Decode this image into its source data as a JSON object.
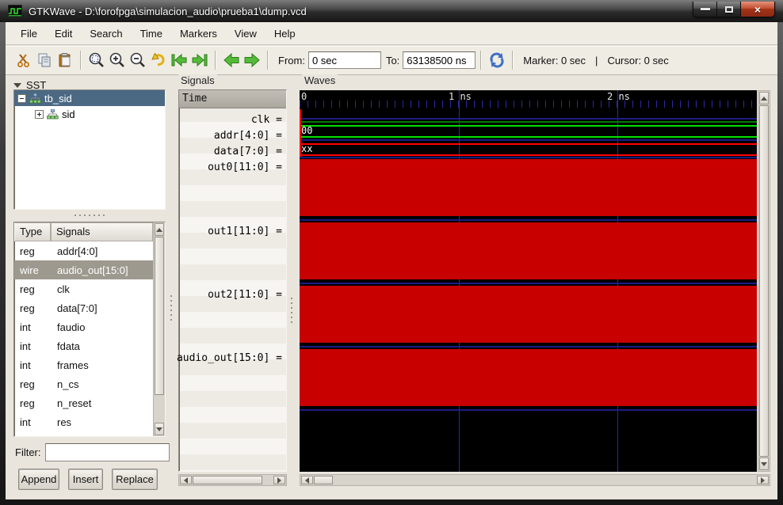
{
  "window": {
    "title": "GTKWave - D:\\forofpga\\simulacion_audio\\prueba1\\dump.vcd",
    "close_glyph": "×"
  },
  "menu": {
    "items": [
      "File",
      "Edit",
      "Search",
      "Time",
      "Markers",
      "View",
      "Help"
    ]
  },
  "toolbar": {
    "from_label": "From:",
    "from_value": "0 sec",
    "to_label": "To:",
    "to_value": "63138500 ns",
    "marker_label": "Marker: 0 sec",
    "divider": "|",
    "cursor_label": "Cursor: 0 sec",
    "icon_names": [
      "cut-icon",
      "copy-icon",
      "paste-icon",
      "zoom-fit-icon",
      "zoom-in-icon",
      "zoom-out-icon",
      "zoom-undo-icon",
      "jump-to-start-icon",
      "jump-to-end-icon",
      "back-arrow-icon",
      "forward-arrow-icon",
      "reload-icon"
    ]
  },
  "sst": {
    "label": "SST",
    "tree": [
      {
        "label": "tb_sid"
      },
      {
        "label": "sid"
      }
    ]
  },
  "signals_table": {
    "headers": {
      "type": "Type",
      "signals": "Signals"
    },
    "rows": [
      {
        "type": "reg",
        "name": "addr[4:0]"
      },
      {
        "type": "wire",
        "name": "audio_out[15:0]"
      },
      {
        "type": "reg",
        "name": "clk"
      },
      {
        "type": "reg",
        "name": "data[7:0]"
      },
      {
        "type": "int",
        "name": "faudio"
      },
      {
        "type": "int",
        "name": "fdata"
      },
      {
        "type": "int",
        "name": "frames"
      },
      {
        "type": "reg",
        "name": "n_cs"
      },
      {
        "type": "reg",
        "name": "n_reset"
      },
      {
        "type": "int",
        "name": "res"
      }
    ]
  },
  "filter": {
    "label": "Filter:",
    "value": ""
  },
  "actions": {
    "append": "Append",
    "insert": "Insert",
    "replace": "Replace"
  },
  "signals_panel": {
    "frame_label": "Signals",
    "time_header": "Time",
    "items": [
      "clk =",
      "addr[4:0] =",
      "data[7:0] =",
      "out0[11:0] =",
      "out1[11:0] =",
      "out2[11:0] =",
      "audio_out[15:0] ="
    ]
  },
  "waves": {
    "frame_label": "Waves",
    "timeline": [
      "0",
      "1 ns",
      "2 ns"
    ],
    "values": {
      "addr": "00",
      "data": "xx"
    },
    "colors": {
      "undefined_fill": "#c80000",
      "bus_green": "#00e000",
      "clk_green": "#007a00",
      "grid_blue": "#2a2aa0",
      "undefined_line_red": "#ff0000"
    }
  }
}
